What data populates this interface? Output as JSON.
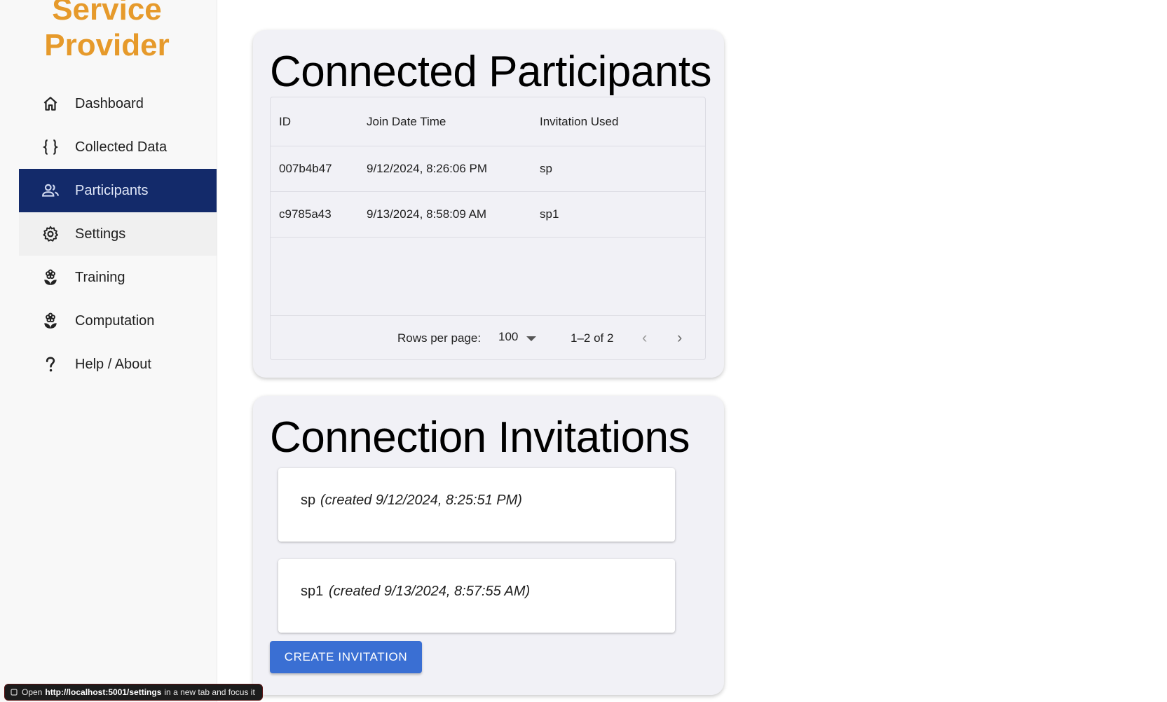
{
  "brand": {
    "line1": "Service",
    "line2": "Provider",
    "color": "#e69a2b"
  },
  "sidebar": {
    "items": [
      {
        "label": "Dashboard",
        "icon": "home-icon"
      },
      {
        "label": "Collected Data",
        "icon": "braces-icon"
      },
      {
        "label": "Participants",
        "icon": "people-icon",
        "active": true
      },
      {
        "label": "Settings",
        "icon": "gear-icon",
        "hovered": true
      },
      {
        "label": "Training",
        "icon": "flower-icon"
      },
      {
        "label": "Computation",
        "icon": "flower-icon"
      },
      {
        "label": "Help / About",
        "icon": "question-icon"
      }
    ],
    "active_color": "#132a6a"
  },
  "participants": {
    "title": "Connected Participants",
    "columns": [
      "ID",
      "Join Date Time",
      "Invitation Used"
    ],
    "rows": [
      {
        "id": "007b4b47",
        "join": "9/12/2024, 8:26:06 PM",
        "invitation": "sp"
      },
      {
        "id": "c9785a43",
        "join": "9/13/2024, 8:58:09 AM",
        "invitation": "sp1"
      }
    ],
    "footer": {
      "rows_per_page_label": "Rows per page:",
      "rows_per_page": "100",
      "range": "1–2 of 2"
    }
  },
  "invitations": {
    "title": "Connection Invitations",
    "items": [
      {
        "name": "sp",
        "created": "(created 9/12/2024, 8:25:51 PM)"
      },
      {
        "name": "sp1",
        "created": "(created 9/13/2024, 8:57:55 AM)"
      }
    ],
    "create_button": "CREATE INVITATION",
    "button_color": "#3a6fd3"
  },
  "status_bar": {
    "prefix": "Open",
    "url": "http://localhost:5001/settings",
    "suffix": "in a new tab and focus it"
  }
}
